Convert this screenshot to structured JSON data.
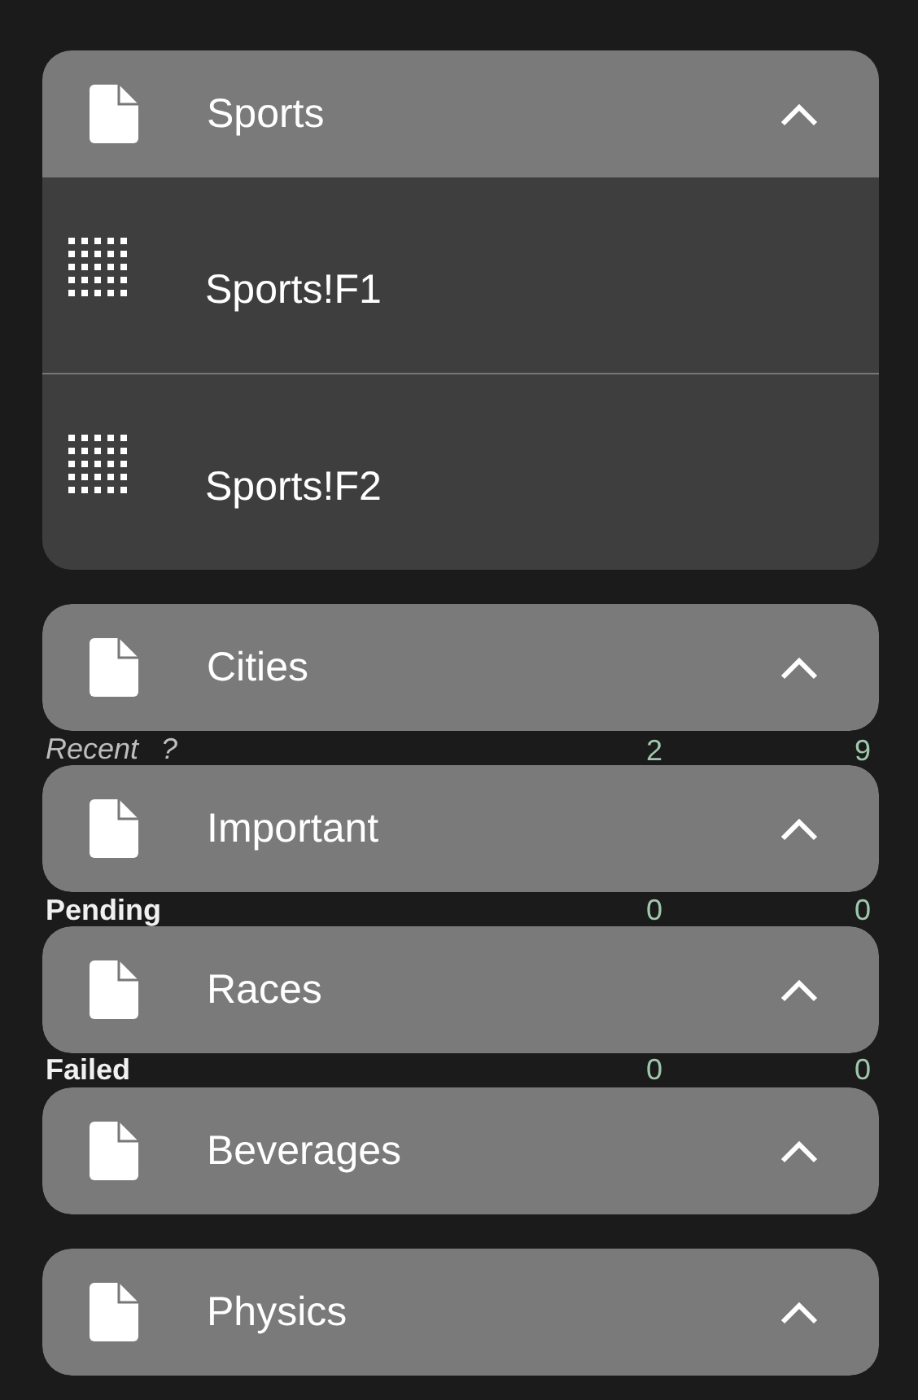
{
  "page": {
    "table": {
      "rows": [
        {
          "kind": "sub",
          "label": "Recent",
          "help": "?",
          "sheet": "2",
          "all": "9"
        },
        {
          "kind": "status",
          "label": "Pending",
          "sheet": "0",
          "all": "0"
        },
        {
          "kind": "status",
          "label": "Failed",
          "sheet": "0",
          "all": "0"
        }
      ]
    }
  },
  "dropdown": {
    "groups": [
      {
        "name": "Sports",
        "expanded": true,
        "items": [
          {
            "label": "Sports!F1"
          },
          {
            "label": "Sports!F2"
          }
        ]
      },
      {
        "name": "Cities",
        "expanded": false
      },
      {
        "name": "Important",
        "expanded": false
      },
      {
        "name": "Races",
        "expanded": false
      },
      {
        "name": "Beverages",
        "expanded": false
      },
      {
        "name": "Physics",
        "expanded": false
      }
    ]
  }
}
